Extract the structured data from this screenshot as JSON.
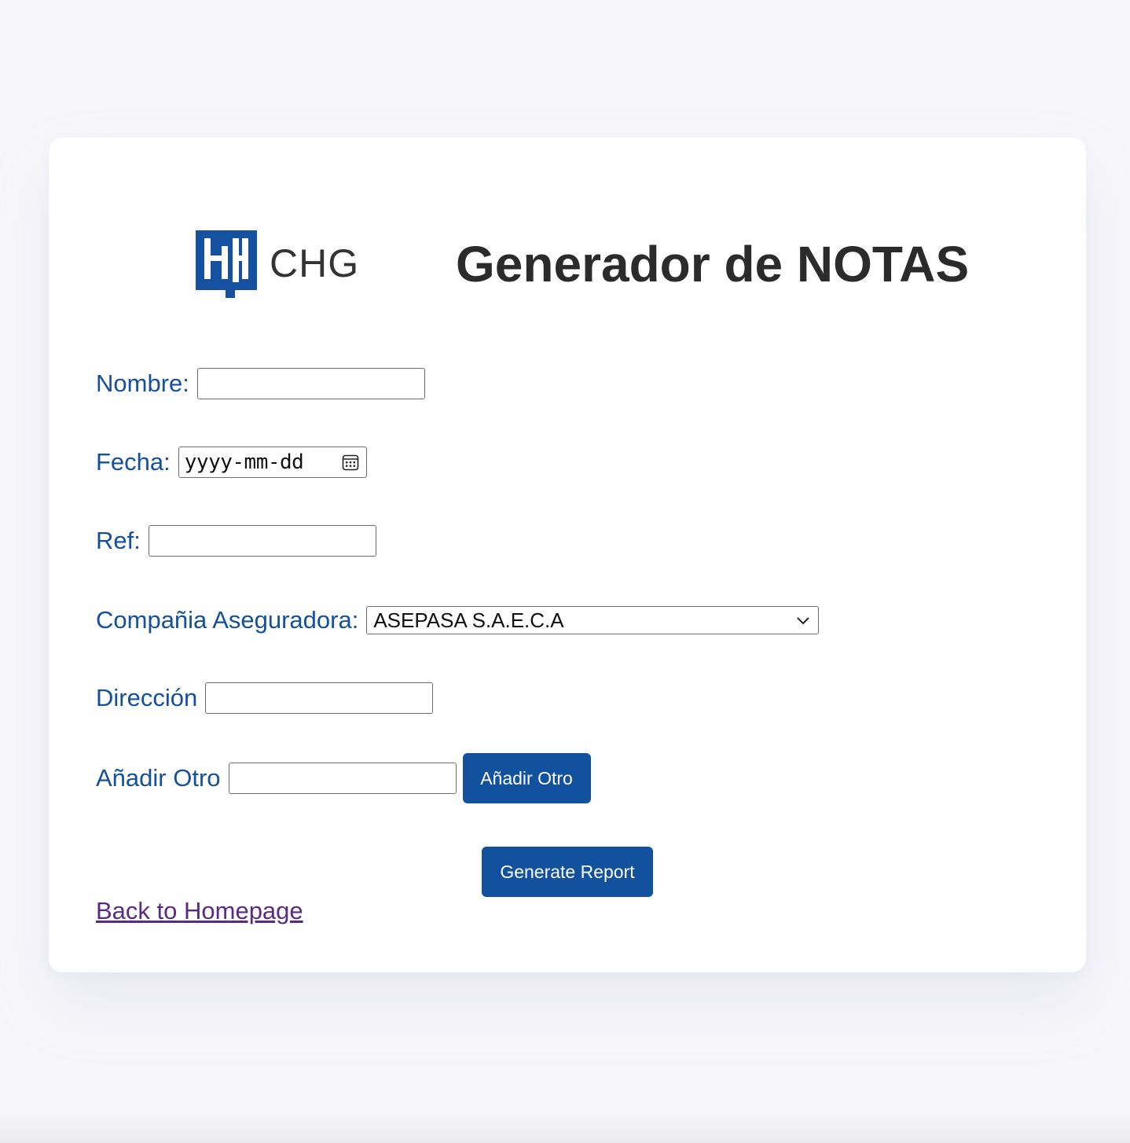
{
  "brand": {
    "logo_text": "CHG",
    "color": "#1451a0"
  },
  "page": {
    "title": "Generador de NOTAS"
  },
  "form": {
    "nombre": {
      "label": "Nombre:",
      "value": ""
    },
    "fecha": {
      "label": "Fecha:",
      "placeholder": "yyyy-mm-dd",
      "icon": "calendar-icon"
    },
    "ref": {
      "label": "Ref:",
      "value": ""
    },
    "compania": {
      "label": "Compañia Aseguradora:",
      "selected": "ASEPASA S.A.E.C.A",
      "icon": "chevron-down-icon"
    },
    "direccion": {
      "label": "Dirección",
      "value": ""
    },
    "anadir": {
      "label": "Añadir Otro",
      "value": "",
      "button_label": "Añadir Otro"
    }
  },
  "actions": {
    "generate_label": "Generate Report",
    "back_link": "Back to Homepage"
  },
  "colors": {
    "label": "#15509a",
    "button": "#12519e",
    "link_visited": "#5a2a86",
    "background": "#f7f7fb"
  }
}
